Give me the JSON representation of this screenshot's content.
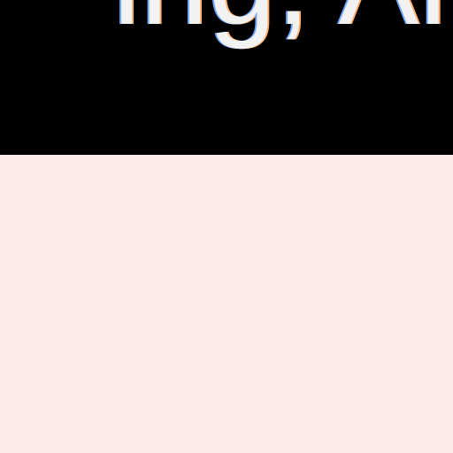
{
  "header": {
    "partial_text": "ing, Ani"
  },
  "colors": {
    "band": "#000000",
    "text": "#f2f2f2",
    "content_background": "#fdebeb"
  }
}
